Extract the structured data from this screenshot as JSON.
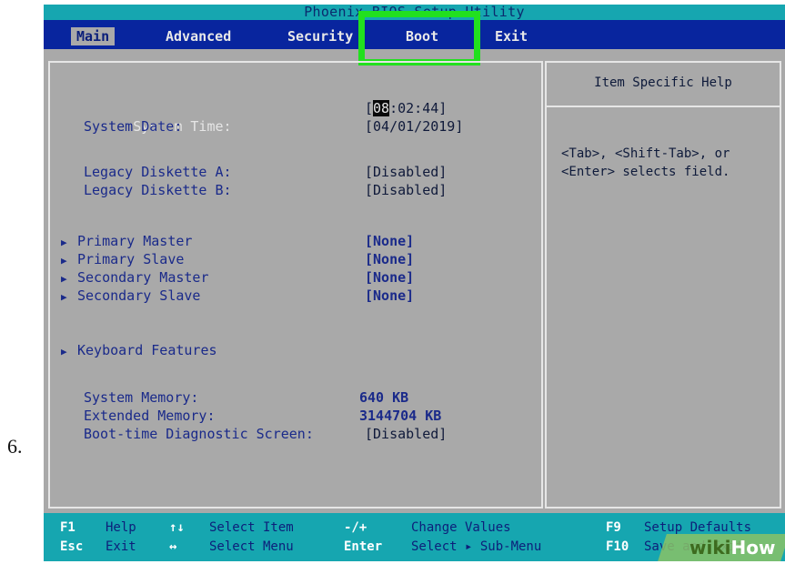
{
  "step_number": "6.",
  "title": "Phoenix BIOS Setup Utility",
  "menu": [
    {
      "label": "Main",
      "active": true
    },
    {
      "label": "Advanced",
      "active": false
    },
    {
      "label": "Security",
      "active": false
    },
    {
      "label": "Boot",
      "active": false
    },
    {
      "label": "Exit",
      "active": false
    }
  ],
  "main": {
    "system_time": {
      "label": "System Time:",
      "value_cursor": "08",
      "value_rest": ":02:44]",
      "value_open": "["
    },
    "system_date": {
      "label": "System Date:",
      "value": "[04/01/2019]"
    },
    "legacy_a": {
      "label": "Legacy Diskette A:",
      "value": "[Disabled]"
    },
    "legacy_b": {
      "label": "Legacy Diskette B:",
      "value": "[Disabled]"
    },
    "submenus": [
      {
        "label": "Primary Master",
        "value": "[None]"
      },
      {
        "label": "Primary Slave",
        "value": "[None]"
      },
      {
        "label": "Secondary Master",
        "value": "[None]"
      },
      {
        "label": "Secondary Slave",
        "value": "[None]"
      }
    ],
    "keyboard": {
      "label": "Keyboard Features"
    },
    "system_memory": {
      "label": "System Memory:",
      "value": "640 KB"
    },
    "extended_memory": {
      "label": "Extended Memory:",
      "value": "3144704 KB"
    },
    "diag_screen": {
      "label": "Boot-time Diagnostic Screen:",
      "value": "[Disabled]"
    }
  },
  "help": {
    "title": "Item Specific Help",
    "line1": "<Tab>, <Shift-Tab>, or",
    "line2": "<Enter> selects field."
  },
  "footer": {
    "r1": [
      {
        "key": "F1",
        "text": "Help"
      },
      {
        "key": "↑↓",
        "text": "Select Item"
      },
      {
        "key": "-/+",
        "text": "Change Values"
      },
      {
        "key": "F9",
        "text": "Setup Defaults"
      }
    ],
    "r2": [
      {
        "key": "Esc",
        "text": "Exit"
      },
      {
        "key": "↔",
        "text": "Select Menu"
      },
      {
        "key": "Enter",
        "text": "Select ▸ Sub-Menu"
      },
      {
        "key": "F10",
        "text": "Save and Exit"
      }
    ]
  },
  "watermark": {
    "wiki": "wiki",
    "how": "How"
  },
  "colors": {
    "menu_bar": "#08259e",
    "title_bar": "#16a6b0",
    "panel": "#a9a9a9",
    "highlight": "#22e01e"
  }
}
